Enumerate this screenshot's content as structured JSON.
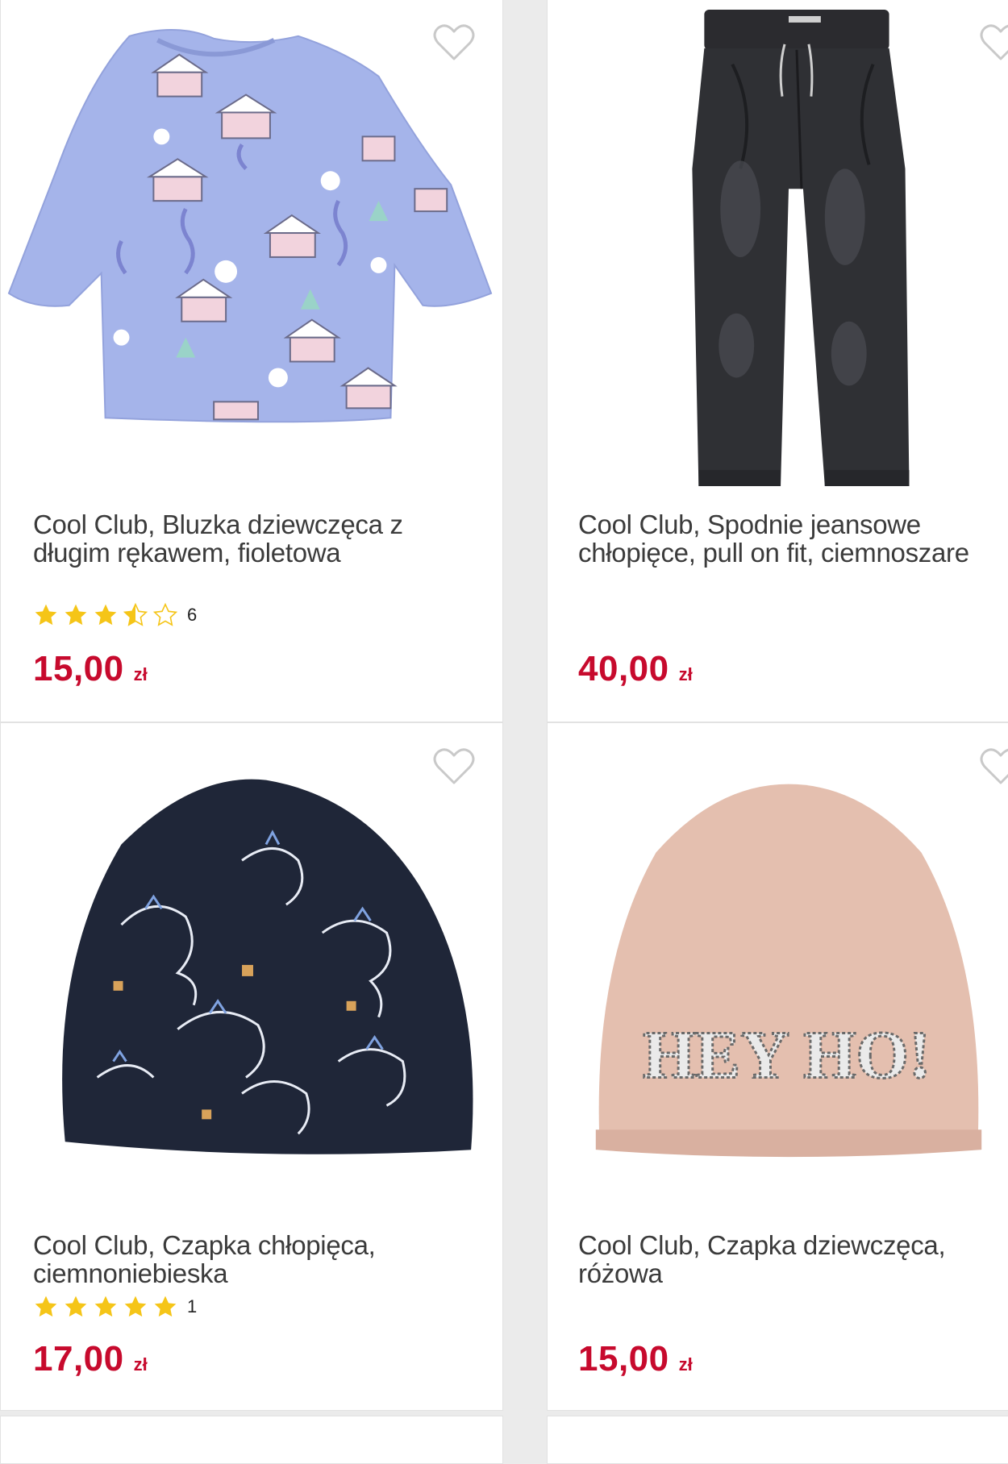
{
  "products": [
    {
      "title": "Cool Club, Bluzka dziewczęca z długim rękawem, fioletowa",
      "rating": 3.5,
      "rating_count": "6",
      "price": "15,00",
      "currency": "zł"
    },
    {
      "title": "Cool Club, Spodnie jeansowe chłopięce, pull on fit, ciemnoszare",
      "price": "40,00",
      "currency": "zł"
    },
    {
      "title": "Cool Club, Czapka chłopięca, ciemnoniebieska",
      "rating": 5,
      "rating_count": "1",
      "price": "17,00",
      "currency": "zł"
    },
    {
      "title": "Cool Club, Czapka dziewczęca, różowa",
      "price": "15,00",
      "currency": "zł",
      "image_text": "HEY HO!"
    }
  ],
  "colors": {
    "price": "#c70a2d",
    "star": "#f5c518",
    "page_bg": "#ebebeb"
  },
  "icons": {
    "favorite": "heart-outline-icon",
    "rating": "star-icon"
  }
}
